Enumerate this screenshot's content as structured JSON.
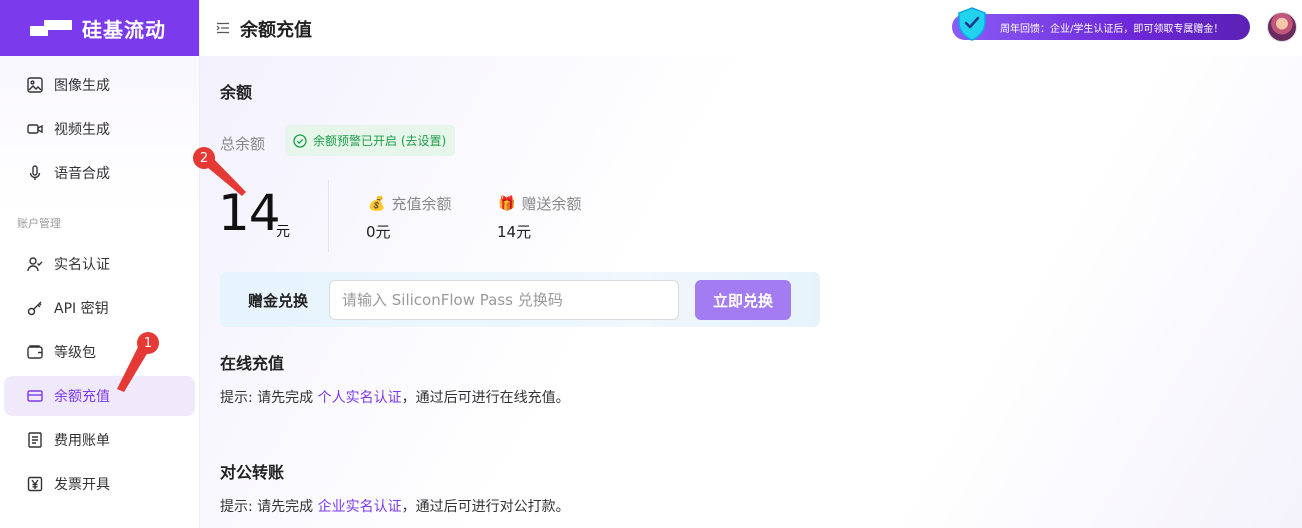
{
  "app": {
    "logo_text": "硅基流动"
  },
  "sidebar": {
    "items_top": [
      {
        "label": "图像生成",
        "icon": "image-icon"
      },
      {
        "label": "视频生成",
        "icon": "video-icon"
      },
      {
        "label": "语音合成",
        "icon": "microphone-icon"
      }
    ],
    "section_title": "账户管理",
    "items_account": [
      {
        "label": "实名认证",
        "icon": "user-check-icon"
      },
      {
        "label": "API 密钥",
        "icon": "key-icon"
      },
      {
        "label": "等级包",
        "icon": "wallet-icon"
      },
      {
        "label": "余额充值",
        "icon": "card-icon",
        "active": true
      },
      {
        "label": "费用账单",
        "icon": "bill-icon"
      },
      {
        "label": "发票开具",
        "icon": "yen-icon"
      }
    ]
  },
  "header": {
    "title": "余额充值",
    "promo_text": "周年回馈：企业/学生认证后，即可领取专属赠金！"
  },
  "balance": {
    "section_title": "余额",
    "total_label": "总余额",
    "alert_badge": "余额预警已开启 (去设置)",
    "total_value": "14",
    "total_unit": "元",
    "recharge_label": "充值余额",
    "recharge_value": "0元",
    "gift_label": "赠送余额",
    "gift_value": "14元"
  },
  "redeem": {
    "label": "赠金兑换",
    "placeholder": "请输入 SiliconFlow Pass 兑换码",
    "button": "立即兑换"
  },
  "online": {
    "title": "在线充值",
    "tip_prefix": "提示: 请先完成 ",
    "tip_link": "个人实名认证",
    "tip_suffix": "，通过后可进行在线充值。"
  },
  "corporate": {
    "title": "对公转账",
    "tip_prefix": "提示: 请先完成 ",
    "tip_link": "企业实名认证",
    "tip_suffix": "，通过后可进行对公打款。"
  },
  "annotations": {
    "one": "1",
    "two": "2"
  },
  "colors": {
    "brand": "#7c3aed",
    "button": "#a47cf2",
    "success": "#1f9d4a",
    "annotation": "#e53935"
  }
}
